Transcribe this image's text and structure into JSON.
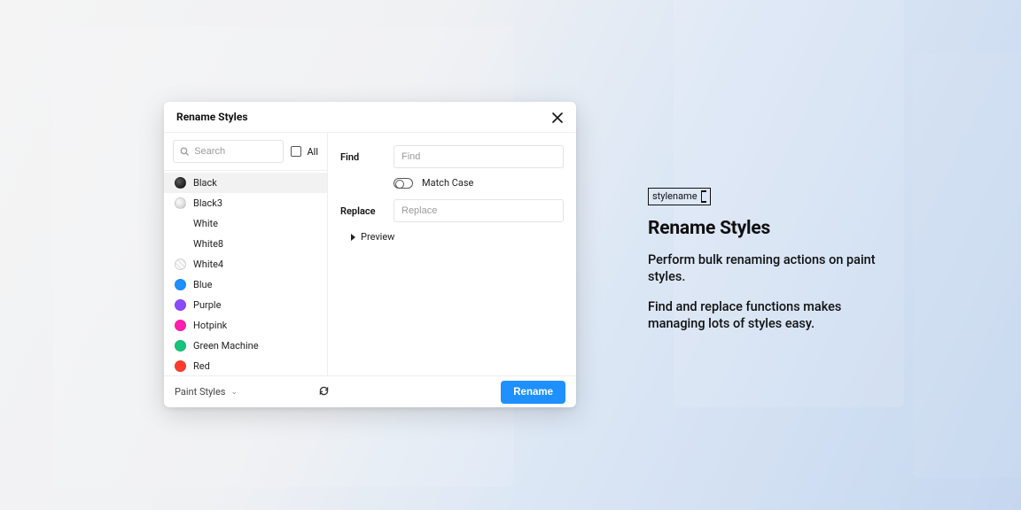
{
  "modal": {
    "title": "Rename Styles",
    "search_placeholder": "Search",
    "all_label": "All",
    "styles": [
      {
        "label": "Black",
        "swatch": "grad-black"
      },
      {
        "label": "Black3",
        "swatch": "grad-silver"
      },
      {
        "label": "White",
        "swatch": ""
      },
      {
        "label": "White8",
        "swatch": ""
      },
      {
        "label": "White4",
        "swatch": "stripes"
      },
      {
        "label": "Blue",
        "swatch": "#1e90ff"
      },
      {
        "label": "Purple",
        "swatch": "#8a4bff"
      },
      {
        "label": "Hotpink",
        "swatch": "#ff1eb0"
      },
      {
        "label": "Green Machine",
        "swatch": "#19c37d"
      },
      {
        "label": "Red",
        "swatch": "#ff3b30"
      }
    ],
    "selected_index": 0,
    "find_label": "Find",
    "find_placeholder": "Find",
    "replace_label": "Replace",
    "replace_placeholder": "Replace",
    "match_case_label": "Match Case",
    "preview_label": "Preview",
    "footer_dropdown": "Paint Styles",
    "primary_button": "Rename"
  },
  "marketing": {
    "badge_text": "stylename",
    "headline": "Rename Styles",
    "p1": "Perform bulk renaming actions on paint styles.",
    "p2": "Find and replace functions makes managing lots of styles easy."
  }
}
